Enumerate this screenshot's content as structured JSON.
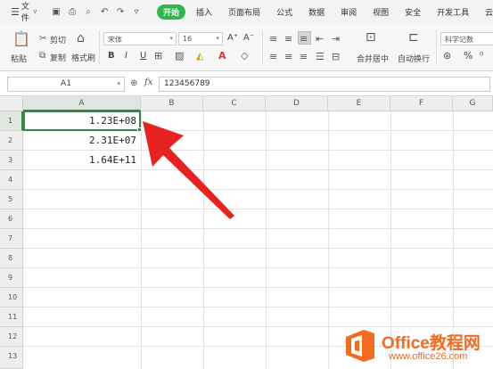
{
  "menu": {
    "file_label": "文件",
    "tabs": [
      "开始",
      "插入",
      "页面布局",
      "公式",
      "数据",
      "审阅",
      "视图",
      "安全",
      "开发工具",
      "云服务"
    ],
    "active_tab": "开始"
  },
  "ribbon": {
    "paste": "粘贴",
    "cut": "剪切",
    "copy": "复制",
    "format_painter": "格式刷",
    "font_name": "宋体",
    "font_size": "16",
    "merge_center": "合并居中",
    "wrap_text": "自动换行",
    "number_format": "科学记数",
    "percent": "%",
    "bold": "B",
    "italic": "I",
    "underline": "U",
    "grow_font": "A⁺",
    "shrink_font": "A⁻"
  },
  "formula_bar": {
    "name_box": "A1",
    "fx": "fx",
    "value": "123456789"
  },
  "grid": {
    "columns": [
      "A",
      "B",
      "C",
      "D",
      "E",
      "F",
      "G"
    ],
    "rows": [
      "1",
      "2",
      "3",
      "4",
      "5",
      "6",
      "7",
      "8",
      "9",
      "10",
      "11",
      "12",
      "13"
    ],
    "cells": {
      "A1": "1.23E+08",
      "A2": "2.31E+07",
      "A3": "1.64E+11"
    },
    "selected_cell": "A1"
  },
  "colors": {
    "accent_green": "#2db84d",
    "selection_green": "#2f8b45",
    "arrow_red": "#e8231f",
    "watermark_orange": "#f26b1f"
  },
  "watermark": {
    "title": "Office教程网",
    "url": "www.office26.com"
  }
}
